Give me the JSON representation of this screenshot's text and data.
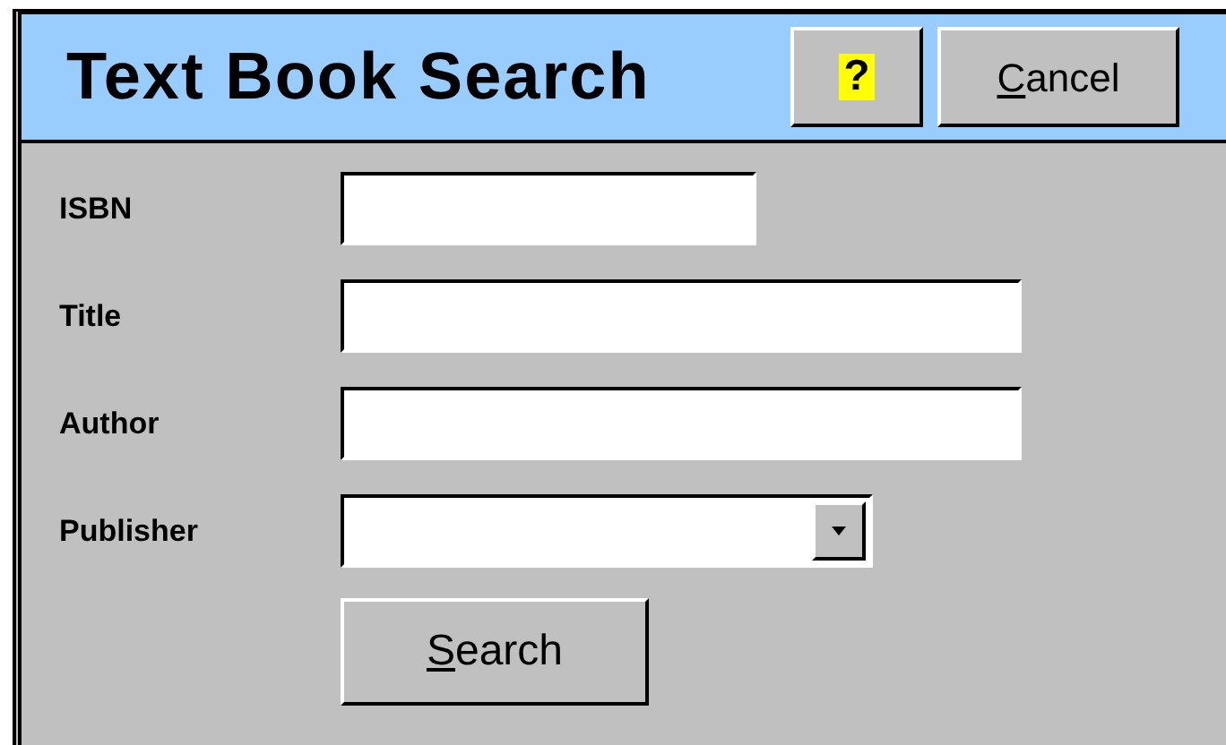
{
  "window": {
    "title": "Text Book Search"
  },
  "header_buttons": [
    {
      "kind": "help",
      "label_rest": "?"
    },
    {
      "kind": "text",
      "mnemonic": "C",
      "label_rest": "ancel"
    }
  ],
  "fields": [
    {
      "label": "ISBN",
      "kind": "text"
    },
    {
      "label": "Title",
      "kind": "text"
    },
    {
      "label": "Author",
      "kind": "text"
    },
    {
      "label": "Publisher",
      "kind": "select"
    }
  ],
  "search_button": {
    "mnemonic": "S",
    "label_rest": "earch"
  }
}
